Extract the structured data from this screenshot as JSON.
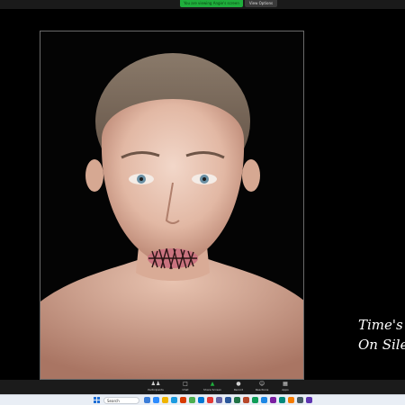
{
  "share_bar": {
    "status_text": "You are viewing Angie's screen",
    "options_label": "View Options"
  },
  "slide": {
    "caption_line1": "Time's U",
    "caption_line2": "On Silen"
  },
  "toolbar": {
    "items": [
      {
        "label": "Participants",
        "icon": "participants-icon"
      },
      {
        "label": "Chat",
        "icon": "chat-icon"
      },
      {
        "label": "Share Screen",
        "icon": "share-screen-icon"
      },
      {
        "label": "Record",
        "icon": "record-icon"
      },
      {
        "label": "Reactions",
        "icon": "reactions-icon"
      },
      {
        "label": "Apps",
        "icon": "apps-icon"
      }
    ]
  },
  "taskbar": {
    "search_placeholder": "Search",
    "accent": "#1f6fd6"
  },
  "colors": {
    "share_green": "#1fae3c",
    "background": "#000000"
  }
}
